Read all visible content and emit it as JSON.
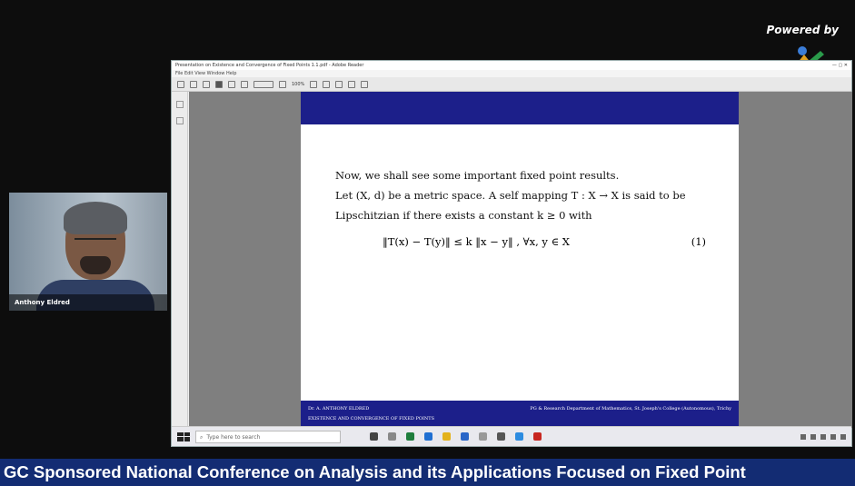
{
  "overlay": {
    "powered_by": "Powered by"
  },
  "webcam": {
    "participant_name": "Anthony Eldred"
  },
  "window": {
    "title": "Presentation on Existence and Convergence of Fixed Points 1.1.pdf - Adobe Reader",
    "menu": "File  Edit  View  Window  Help",
    "zoom": "100%"
  },
  "slide": {
    "line1": "Now, we shall see some important fixed point results.",
    "line2": "Let (X, d) be a metric space. A self mapping T : X → X is said to be",
    "line3": "Lipschitzian if there exists a constant k ≥ 0 with",
    "equation": "‖T(x) − T(y)‖ ≤ k ‖x − y‖ , ∀x, y ∈ X",
    "eq_number": "(1)",
    "footer_left": "Dr. A. ANTHONY ELDRED",
    "footer_right": "PG & Research Department of Mathematics, St. Joseph's College (Autonomous), Trichy",
    "footer_title": "EXISTENCE AND CONVERGENCE OF FIXED POINTS"
  },
  "taskbar": {
    "search_placeholder": "Type here to search"
  },
  "banner": {
    "text": "GC Sponsored National Conference on Analysis and its Applications Focused on Fixed Point"
  },
  "colors": {
    "slide_header": "#1c1f8a",
    "banner": "#132c73"
  }
}
